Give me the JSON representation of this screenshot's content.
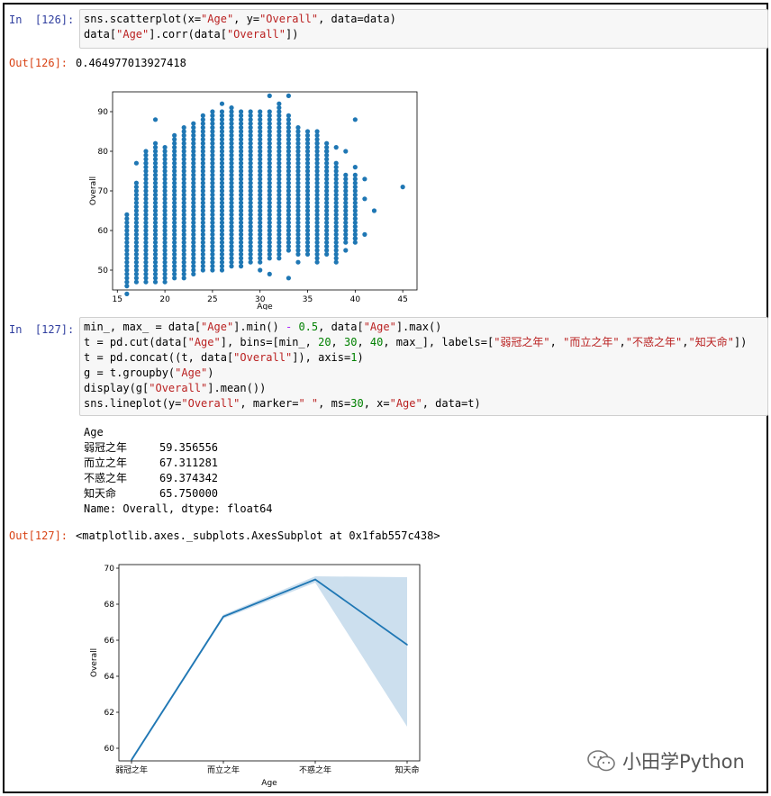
{
  "cell126": {
    "in_prompt": "In  [126]:",
    "code": [
      [
        [
          "sns.scatterplot(x=",
          ""
        ],
        [
          "\"Age\"",
          "str"
        ],
        [
          ", y=",
          ""
        ],
        [
          "\"Overall\"",
          "str"
        ],
        [
          ", data=data)",
          ""
        ]
      ],
      [
        [
          "data[",
          ""
        ],
        [
          "\"Age\"",
          "str"
        ],
        [
          "].corr(data[",
          ""
        ],
        [
          "\"Overall\"",
          "str"
        ],
        [
          "])",
          ""
        ]
      ]
    ],
    "out_prompt": "Out[126]:",
    "out_value": "0.464977013927418"
  },
  "cell127": {
    "in_prompt": "In  [127]:",
    "code": [
      [
        [
          "min_, max_ = data[",
          ""
        ],
        [
          "\"Age\"",
          "str"
        ],
        [
          "].min() ",
          ""
        ],
        [
          "-",
          "op"
        ],
        [
          " ",
          ""
        ],
        [
          "0.5",
          "num"
        ],
        [
          ", data[",
          ""
        ],
        [
          "\"Age\"",
          "str"
        ],
        [
          "].max()",
          ""
        ]
      ],
      [
        [
          "t = pd.cut(data[",
          ""
        ],
        [
          "\"Age\"",
          "str"
        ],
        [
          "], bins=[min_, ",
          ""
        ],
        [
          "20",
          "num"
        ],
        [
          ", ",
          ""
        ],
        [
          "30",
          "num"
        ],
        [
          ", ",
          ""
        ],
        [
          "40",
          "num"
        ],
        [
          ", max_], labels=[",
          ""
        ],
        [
          "\"弱冠之年\"",
          "str"
        ],
        [
          ", ",
          ""
        ],
        [
          "\"而立之年\"",
          "str"
        ],
        [
          ",",
          ""
        ],
        [
          "\"不惑之年\"",
          "str"
        ],
        [
          ",",
          ""
        ],
        [
          "\"知天命\"",
          "str"
        ],
        [
          "])",
          ""
        ]
      ],
      [
        [
          "t = pd.concat((t, data[",
          ""
        ],
        [
          "\"Overall\"",
          "str"
        ],
        [
          "]), axis=",
          ""
        ],
        [
          "1",
          "num"
        ],
        [
          ")",
          ""
        ]
      ],
      [
        [
          "g = t.groupby(",
          ""
        ],
        [
          "\"Age\"",
          "str"
        ],
        [
          ")",
          ""
        ]
      ],
      [
        [
          "display(g[",
          ""
        ],
        [
          "\"Overall\"",
          "str"
        ],
        [
          "].mean())",
          ""
        ]
      ],
      [
        [
          "sns.lineplot(y=",
          ""
        ],
        [
          "\"Overall\"",
          "str"
        ],
        [
          ", marker=",
          ""
        ],
        [
          "\" \"",
          "str"
        ],
        [
          ", ms=",
          ""
        ],
        [
          "30",
          "num"
        ],
        [
          ", x=",
          ""
        ],
        [
          "\"Age\"",
          "str"
        ],
        [
          ", data=t)",
          ""
        ]
      ]
    ],
    "series_header": "Age",
    "series_rows": [
      {
        "label": "弱冠之年",
        "value": "59.356556"
      },
      {
        "label": "而立之年",
        "value": "67.311281"
      },
      {
        "label": "不惑之年",
        "value": "69.374342"
      },
      {
        "label": "知天命",
        "value": "65.750000"
      }
    ],
    "series_footer": "Name: Overall, dtype: float64",
    "out_prompt": "Out[127]:",
    "out_value": "<matplotlib.axes._subplots.AxesSubplot at 0x1fab557c438>"
  },
  "colors": {
    "series": "#1f77b4",
    "band": "#aac9e2",
    "in_prompt": "#303f9f",
    "out_prompt": "#d84315",
    "string": "#ba2121",
    "number": "#008000"
  },
  "watermark": {
    "icon": "wechat-icon",
    "text": "小田学Python"
  },
  "chart_data": [
    {
      "type": "scatter",
      "title": "",
      "xlabel": "Age",
      "ylabel": "Overall",
      "xlim": [
        14.5,
        46.5
      ],
      "ylim": [
        45,
        95
      ],
      "xticks": [
        15,
        20,
        25,
        30,
        35,
        40,
        45
      ],
      "yticks": [
        50,
        60,
        70,
        80,
        90
      ],
      "grid": false,
      "columns": [
        {
          "x": 16,
          "min": 46,
          "max": 64
        },
        {
          "x": 17,
          "min": 47,
          "max": 72
        },
        {
          "x": 18,
          "min": 47,
          "max": 80
        },
        {
          "x": 19,
          "min": 47,
          "max": 82
        },
        {
          "x": 20,
          "min": 47,
          "max": 81
        },
        {
          "x": 21,
          "min": 48,
          "max": 84
        },
        {
          "x": 22,
          "min": 48,
          "max": 86
        },
        {
          "x": 23,
          "min": 49,
          "max": 87
        },
        {
          "x": 24,
          "min": 50,
          "max": 89
        },
        {
          "x": 25,
          "min": 50,
          "max": 90
        },
        {
          "x": 26,
          "min": 50,
          "max": 90
        },
        {
          "x": 27,
          "min": 51,
          "max": 91
        },
        {
          "x": 28,
          "min": 51,
          "max": 90
        },
        {
          "x": 29,
          "min": 52,
          "max": 90
        },
        {
          "x": 30,
          "min": 52,
          "max": 90
        },
        {
          "x": 31,
          "min": 53,
          "max": 90
        },
        {
          "x": 32,
          "min": 54,
          "max": 91
        },
        {
          "x": 33,
          "min": 55,
          "max": 89
        },
        {
          "x": 34,
          "min": 54,
          "max": 86
        },
        {
          "x": 35,
          "min": 54,
          "max": 85
        },
        {
          "x": 36,
          "min": 53,
          "max": 85
        },
        {
          "x": 37,
          "min": 55,
          "max": 82
        },
        {
          "x": 38,
          "min": 53,
          "max": 77
        },
        {
          "x": 39,
          "min": 57,
          "max": 74
        },
        {
          "x": 40,
          "min": 57,
          "max": 74
        }
      ],
      "outliers": [
        {
          "x": 19,
          "y": 88
        },
        {
          "x": 16,
          "y": 44
        },
        {
          "x": 17,
          "y": 77
        },
        {
          "x": 18,
          "y": 77
        },
        {
          "x": 26,
          "y": 92
        },
        {
          "x": 31,
          "y": 94
        },
        {
          "x": 33,
          "y": 94
        },
        {
          "x": 32,
          "y": 92
        },
        {
          "x": 31,
          "y": 49
        },
        {
          "x": 33,
          "y": 48
        },
        {
          "x": 30,
          "y": 50
        },
        {
          "x": 32,
          "y": 53
        },
        {
          "x": 34,
          "y": 52
        },
        {
          "x": 36,
          "y": 52
        },
        {
          "x": 38,
          "y": 52
        },
        {
          "x": 37,
          "y": 54
        },
        {
          "x": 39,
          "y": 80
        },
        {
          "x": 39,
          "y": 55
        },
        {
          "x": 40,
          "y": 88
        },
        {
          "x": 40,
          "y": 76
        },
        {
          "x": 40,
          "y": 58
        },
        {
          "x": 41,
          "y": 73
        },
        {
          "x": 41,
          "y": 68
        },
        {
          "x": 41,
          "y": 59
        },
        {
          "x": 42,
          "y": 65
        },
        {
          "x": 45,
          "y": 71
        },
        {
          "x": 36,
          "y": 82
        },
        {
          "x": 37,
          "y": 80
        },
        {
          "x": 38,
          "y": 81
        },
        {
          "x": 35,
          "y": 83
        }
      ]
    },
    {
      "type": "line",
      "title": "",
      "xlabel": "Age",
      "ylabel": "Overall",
      "categories": [
        "弱冠之年",
        "而立之年",
        "不惑之年",
        "知天命"
      ],
      "ylim": [
        59.3,
        70.2
      ],
      "yticks": [
        60,
        62,
        64,
        66,
        68,
        70
      ],
      "grid": false,
      "series": [
        {
          "values": [
            59.356556,
            67.311281,
            69.374342,
            65.75
          ],
          "ci_low": [
            59.25,
            67.2,
            69.2,
            61.2
          ],
          "ci_high": [
            59.45,
            67.42,
            69.55,
            69.5
          ]
        }
      ]
    }
  ]
}
